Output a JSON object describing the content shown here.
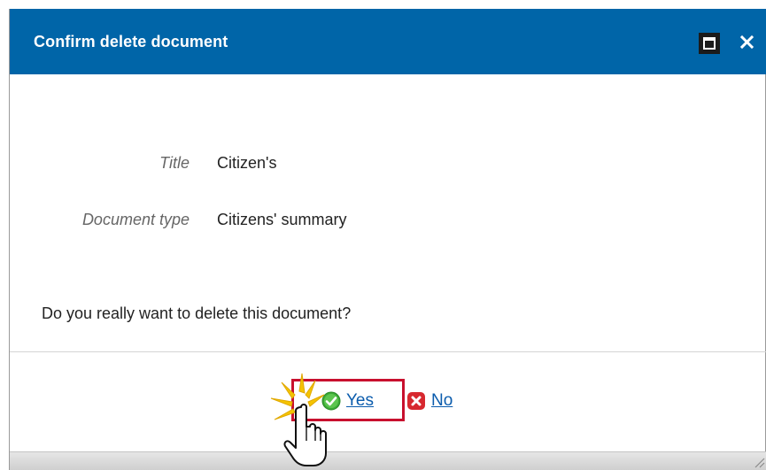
{
  "dialog": {
    "title": "Confirm delete document",
    "maximize_icon": "maximize-icon",
    "close_icon": "close-icon",
    "fields": [
      {
        "label": "Title",
        "value": "Citizen's"
      },
      {
        "label": "Document type",
        "value": "Citizens' summary"
      }
    ],
    "question": "Do you really want to delete this document?",
    "actions": {
      "yes_label": "Yes",
      "yes_icon": "check-circle-icon",
      "no_label": "No",
      "no_icon": "x-square-icon"
    }
  },
  "colors": {
    "titlebar": "#0065a8",
    "link": "#0b5cad",
    "highlight": "#c8102e",
    "yes_icon": "#3aaa35",
    "no_icon": "#d7282f"
  }
}
